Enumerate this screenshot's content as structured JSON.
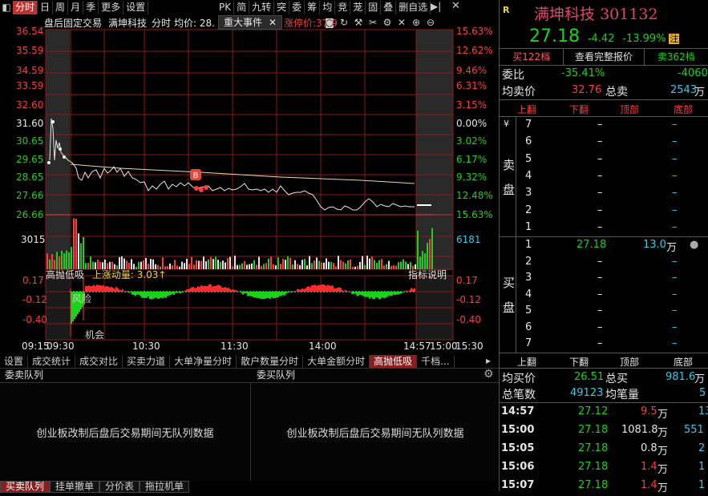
{
  "toolbar": {
    "items": [
      "分时",
      "日",
      "周",
      "月",
      "季",
      "更多",
      "设置"
    ],
    "right_items": [
      "PK",
      "简",
      "九转",
      "突",
      "委",
      "筹",
      "均",
      "竞",
      "茏",
      "固",
      "叠",
      "删自选"
    ]
  },
  "chart_title": {
    "name": "盘后固定交易",
    "stock": "满坤科技",
    "mode": "分时",
    "avg_label": "均价: 28.",
    "event_tag": "重大事件",
    "limit_label": "涨停价:37.9"
  },
  "price_axis": {
    "left": [
      "36.54",
      "35.59",
      "34.59",
      "33.59",
      "32.60",
      "31.60",
      "30.65",
      "29.65",
      "28.65",
      "27.66",
      "26.66"
    ],
    "right": [
      "15.63%",
      "12.62%",
      "9.46%",
      "6.31%",
      "3.15%",
      "0.00%",
      "3.02%",
      "6.17%",
      "9.32%",
      "12.48%",
      "15.63%"
    ],
    "volume_left": "3015",
    "volume_right": "6181"
  },
  "indicator": {
    "name": "高抛低吸",
    "param": "上涨动量: 3.03↑",
    "help": "指标说明",
    "left": [
      "0.17",
      "-0.12",
      "-0.40"
    ],
    "right": [
      "0.17",
      "-0.12",
      "-0.40"
    ],
    "label_risk": "风险",
    "label_chance": "机会"
  },
  "time_axis": [
    "09:15",
    "09:30",
    "10:30",
    "11:30",
    "14:00",
    "14:57",
    "15:00",
    "15:30"
  ],
  "marker_b": "B",
  "bottom_tabs": [
    "设置",
    "成交统计",
    "成交对比",
    "买卖力道",
    "大单净量分时",
    "散户数量分时",
    "大单金额分时",
    "高抛低吸",
    "千档..."
  ],
  "queue": {
    "sell_title": "委卖队列",
    "buy_title": "委买队列",
    "message": "创业板改制后盘后交易期间无队列数据"
  },
  "footer_tabs": [
    "买卖队列",
    "挂单撤单",
    "分价表",
    "拖拉机单"
  ],
  "quote": {
    "flag": "R",
    "name": "满坤科技",
    "code": "301132",
    "price": "27.18",
    "change": "-4.42",
    "change_pct": "-13.99%",
    "badge": "注",
    "buy_btn": "买122档",
    "full_btn": "查看完整报价",
    "sell_btn": "卖362档",
    "wei_bi_label": "委比",
    "wei_bi": "-35.41%",
    "wei_cha": "-4060",
    "avg_sell_label": "均卖价",
    "avg_sell": "32.76",
    "total_sell_label": "总卖",
    "total_sell": "2543",
    "total_sell_unit": "万",
    "col_headers": [
      "上翻",
      "下翻",
      "顶部",
      "底部"
    ],
    "sell_label_1": "卖",
    "sell_label_2": "盘",
    "sell_levels": [
      "7",
      "6",
      "5",
      "4",
      "3",
      "2",
      "1"
    ],
    "dash": "–",
    "yen": "¥",
    "buy_label_1": "买",
    "buy_label_2": "盘",
    "buy_levels": [
      "1",
      "2",
      "3",
      "4",
      "5",
      "6",
      "7"
    ],
    "buy1_price": "27.18",
    "buy1_vol": "13.0",
    "buy1_unit": "万",
    "avg_buy_label": "均买价",
    "avg_buy": "26.51",
    "total_buy_label": "总买",
    "total_buy": "981.6",
    "total_buy_unit": "万",
    "total_trades_label": "总笔数",
    "total_trades": "49123",
    "avg_vol_label": "均笔量",
    "avg_vol": "5",
    "ticks": [
      {
        "time": "14:57",
        "price": "27.12",
        "vol": "9.5",
        "unit": "万",
        "n": "13"
      },
      {
        "time": "15:00",
        "price": "27.18",
        "vol": "1081.8",
        "unit": "万",
        "n": "551"
      },
      {
        "time": "15:05",
        "price": "27.18",
        "vol": "0.8",
        "unit": "万",
        "n": "2"
      },
      {
        "time": "15:06",
        "price": "27.18",
        "vol": "1.4",
        "unit": "万",
        "n": "1"
      },
      {
        "time": "15:07",
        "price": "27.18",
        "vol": "1.4",
        "unit": "万",
        "n": "1"
      }
    ]
  }
}
